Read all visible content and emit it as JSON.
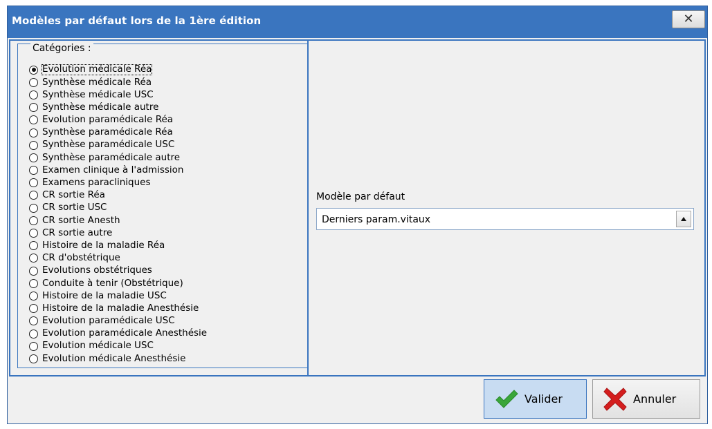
{
  "window": {
    "title": "Modèles par défaut lors de la 1ère édition",
    "close_label": "✕"
  },
  "categories": {
    "legend": "Catégories :",
    "selected_index": 0,
    "items": [
      "Evolution médicale Réa",
      "Synthèse médicale Réa",
      "Synthèse médicale USC",
      "Synthèse médicale autre",
      "Evolution paramédicale Réa",
      "Synthèse paramédicale Réa",
      "Synthèse paramédicale USC",
      "Synthèse paramédicale autre",
      "Examen clinique à l'admission",
      "Examens paracliniques",
      "CR sortie Réa",
      "CR sortie USC",
      "CR sortie Anesth",
      "CR sortie autre",
      "Histoire de la maladie Réa",
      "CR d'obstétrique",
      "Evolutions obstétriques",
      "Conduite à tenir (Obstétrique)",
      "Histoire de la maladie USC",
      "Histoire de la maladie Anesthésie",
      "Evolution paramédicale USC",
      "Evolution paramédicale Anesthésie",
      "Evolution médicale USC",
      "Evolution médicale Anesthésie"
    ]
  },
  "model": {
    "label": "Modèle par défaut",
    "selected_value": "Derniers param.vitaux"
  },
  "buttons": {
    "ok_label": "Valider",
    "cancel_label": "Annuler"
  },
  "colors": {
    "titlebar": "#3a75bf",
    "border": "#3a75bf",
    "ok_check": "#3aa63a",
    "cancel_x": "#d41e1e"
  },
  "icons": {
    "ok": "check-icon",
    "cancel": "cross-icon",
    "dropdown": "dropdown-arrow-icon"
  }
}
